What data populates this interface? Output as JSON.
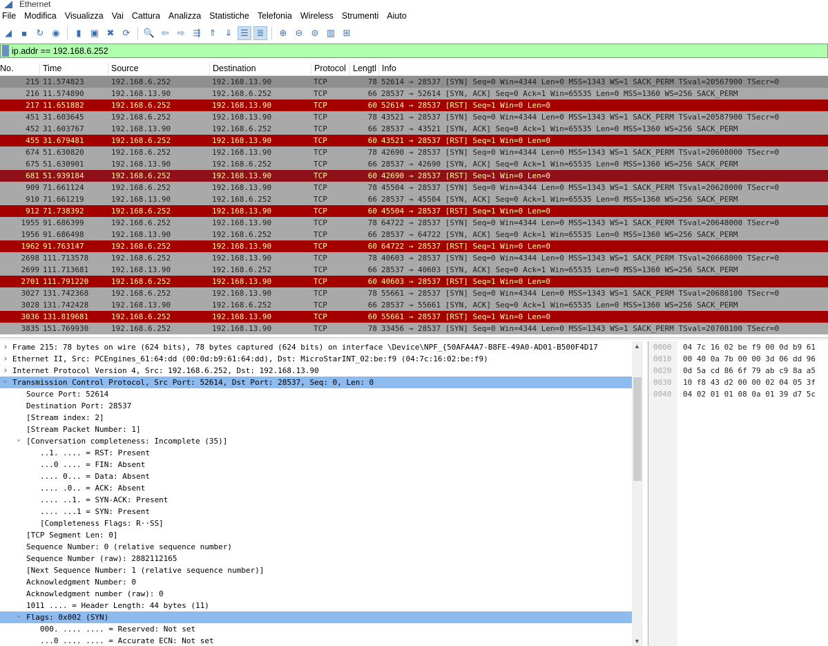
{
  "window": {
    "title": "Ethernet"
  },
  "menu": [
    "File",
    "Modifica",
    "Visualizza",
    "Vai",
    "Cattura",
    "Analizza",
    "Statistiche",
    "Telefonia",
    "Wireless",
    "Strumenti",
    "Aiuto"
  ],
  "toolbar": [
    {
      "name": "start-capture-icon",
      "glyph": "◢"
    },
    {
      "name": "stop-capture-icon",
      "glyph": "■"
    },
    {
      "name": "restart-capture-icon",
      "glyph": "↻"
    },
    {
      "name": "capture-options-icon",
      "glyph": "◉"
    },
    {
      "sep": true
    },
    {
      "name": "open-file-icon",
      "glyph": "▮"
    },
    {
      "name": "save-file-icon",
      "glyph": "▣"
    },
    {
      "name": "close-file-icon",
      "glyph": "✖"
    },
    {
      "name": "reload-file-icon",
      "glyph": "⟳"
    },
    {
      "sep": true
    },
    {
      "name": "find-packet-icon",
      "glyph": "🔍"
    },
    {
      "name": "go-back-icon",
      "glyph": "⇦"
    },
    {
      "name": "go-forward-icon",
      "glyph": "⇨"
    },
    {
      "name": "go-to-packet-icon",
      "glyph": "⇶"
    },
    {
      "name": "first-packet-icon",
      "glyph": "⇑"
    },
    {
      "name": "last-packet-icon",
      "glyph": "⇓"
    },
    {
      "name": "autoscroll-icon",
      "glyph": "☰",
      "active": true
    },
    {
      "name": "colorize-icon",
      "glyph": "≣",
      "active": true
    },
    {
      "sep": true
    },
    {
      "name": "zoom-in-icon",
      "glyph": "⊕"
    },
    {
      "name": "zoom-out-icon",
      "glyph": "⊖"
    },
    {
      "name": "zoom-reset-icon",
      "glyph": "⊜"
    },
    {
      "name": "resize-columns-icon",
      "glyph": "▥"
    },
    {
      "name": "layout-icon",
      "glyph": "⊞"
    }
  ],
  "filter": {
    "value": "ip.addr == 192.168.6.252"
  },
  "columns": [
    "No.",
    "Time",
    "Source",
    "Destination",
    "Protocol",
    "Lengtl",
    "Info"
  ],
  "packets": [
    {
      "no": "215",
      "time": "11.574823",
      "src": "192.168.6.252",
      "dst": "192.168.13.90",
      "proto": "TCP",
      "len": "78",
      "info": "52614 → 28537 [SYN] Seq=0 Win=4344 Len=0 MSS=1343 WS=1 SACK_PERM TSval=20567900 TSecr=0",
      "style": "sel"
    },
    {
      "no": "216",
      "time": "11.574890",
      "src": "192.168.13.90",
      "dst": "192.168.6.252",
      "proto": "TCP",
      "len": "66",
      "info": "28537 → 52614 [SYN, ACK] Seq=0 Ack=1 Win=65535 Len=0 MSS=1360 WS=256 SACK_PERM",
      "style": "ok"
    },
    {
      "no": "217",
      "time": "11.651882",
      "src": "192.168.6.252",
      "dst": "192.168.13.90",
      "proto": "TCP",
      "len": "60",
      "info": "52614 → 28537 [RST] Seq=1 Win=0 Len=0",
      "style": "rst"
    },
    {
      "no": "451",
      "time": "31.603645",
      "src": "192.168.6.252",
      "dst": "192.168.13.90",
      "proto": "TCP",
      "len": "78",
      "info": "43521 → 28537 [SYN] Seq=0 Win=4344 Len=0 MSS=1343 WS=1 SACK_PERM TSval=20587900 TSecr=0",
      "style": "ok"
    },
    {
      "no": "452",
      "time": "31.603767",
      "src": "192.168.13.90",
      "dst": "192.168.6.252",
      "proto": "TCP",
      "len": "66",
      "info": "28537 → 43521 [SYN, ACK] Seq=0 Ack=1 Win=65535 Len=0 MSS=1360 WS=256 SACK_PERM",
      "style": "ok"
    },
    {
      "no": "455",
      "time": "31.679481",
      "src": "192.168.6.252",
      "dst": "192.168.13.90",
      "proto": "TCP",
      "len": "60",
      "info": "43521 → 28537 [RST] Seq=1 Win=0 Len=0",
      "style": "rst"
    },
    {
      "no": "674",
      "time": "51.630820",
      "src": "192.168.6.252",
      "dst": "192.168.13.90",
      "proto": "TCP",
      "len": "78",
      "info": "42690 → 28537 [SYN] Seq=0 Win=4344 Len=0 MSS=1343 WS=1 SACK_PERM TSval=20608000 TSecr=0",
      "style": "ok"
    },
    {
      "no": "675",
      "time": "51.630901",
      "src": "192.168.13.90",
      "dst": "192.168.6.252",
      "proto": "TCP",
      "len": "66",
      "info": "28537 → 42690 [SYN, ACK] Seq=0 Ack=1 Win=65535 Len=0 MSS=1360 WS=256 SACK_PERM",
      "style": "ok"
    },
    {
      "no": "681",
      "time": "51.939184",
      "src": "192.168.6.252",
      "dst": "192.168.13.90",
      "proto": "TCP",
      "len": "60",
      "info": "42690 → 28537 [RST] Seq=1 Win=0 Len=0",
      "style": "mark"
    },
    {
      "no": "909",
      "time": "71.661124",
      "src": "192.168.6.252",
      "dst": "192.168.13.90",
      "proto": "TCP",
      "len": "78",
      "info": "45504 → 28537 [SYN] Seq=0 Win=4344 Len=0 MSS=1343 WS=1 SACK_PERM TSval=20628000 TSecr=0",
      "style": "ok"
    },
    {
      "no": "910",
      "time": "71.661219",
      "src": "192.168.13.90",
      "dst": "192.168.6.252",
      "proto": "TCP",
      "len": "66",
      "info": "28537 → 45504 [SYN, ACK] Seq=0 Ack=1 Win=65535 Len=0 MSS=1360 WS=256 SACK_PERM",
      "style": "ok"
    },
    {
      "no": "912",
      "time": "71.738392",
      "src": "192.168.6.252",
      "dst": "192.168.13.90",
      "proto": "TCP",
      "len": "60",
      "info": "45504 → 28537 [RST] Seq=1 Win=0 Len=0",
      "style": "rst"
    },
    {
      "no": "1955",
      "time": "91.686399",
      "src": "192.168.6.252",
      "dst": "192.168.13.90",
      "proto": "TCP",
      "len": "78",
      "info": "64722 → 28537 [SYN] Seq=0 Win=4344 Len=0 MSS=1343 WS=1 SACK_PERM TSval=20648000 TSecr=0",
      "style": "ok"
    },
    {
      "no": "1956",
      "time": "91.686498",
      "src": "192.168.13.90",
      "dst": "192.168.6.252",
      "proto": "TCP",
      "len": "66",
      "info": "28537 → 64722 [SYN, ACK] Seq=0 Ack=1 Win=65535 Len=0 MSS=1360 WS=256 SACK_PERM",
      "style": "ok"
    },
    {
      "no": "1962",
      "time": "91.763147",
      "src": "192.168.6.252",
      "dst": "192.168.13.90",
      "proto": "TCP",
      "len": "60",
      "info": "64722 → 28537 [RST] Seq=1 Win=0 Len=0",
      "style": "rst"
    },
    {
      "no": "2698",
      "time": "111.713578",
      "src": "192.168.6.252",
      "dst": "192.168.13.90",
      "proto": "TCP",
      "len": "78",
      "info": "40603 → 28537 [SYN] Seq=0 Win=4344 Len=0 MSS=1343 WS=1 SACK_PERM TSval=20668000 TSecr=0",
      "style": "ok"
    },
    {
      "no": "2699",
      "time": "111.713681",
      "src": "192.168.13.90",
      "dst": "192.168.6.252",
      "proto": "TCP",
      "len": "66",
      "info": "28537 → 40603 [SYN, ACK] Seq=0 Ack=1 Win=65535 Len=0 MSS=1360 WS=256 SACK_PERM",
      "style": "ok"
    },
    {
      "no": "2701",
      "time": "111.791220",
      "src": "192.168.6.252",
      "dst": "192.168.13.90",
      "proto": "TCP",
      "len": "60",
      "info": "40603 → 28537 [RST] Seq=1 Win=0 Len=0",
      "style": "rst"
    },
    {
      "no": "3027",
      "time": "131.742368",
      "src": "192.168.6.252",
      "dst": "192.168.13.90",
      "proto": "TCP",
      "len": "78",
      "info": "55661 → 28537 [SYN] Seq=0 Win=4344 Len=0 MSS=1343 WS=1 SACK_PERM TSval=20688100 TSecr=0",
      "style": "ok"
    },
    {
      "no": "3028",
      "time": "131.742428",
      "src": "192.168.13.90",
      "dst": "192.168.6.252",
      "proto": "TCP",
      "len": "66",
      "info": "28537 → 55661 [SYN, ACK] Seq=0 Ack=1 Win=65535 Len=0 MSS=1360 WS=256 SACK_PERM",
      "style": "ok"
    },
    {
      "no": "3036",
      "time": "131.819681",
      "src": "192.168.6.252",
      "dst": "192.168.13.90",
      "proto": "TCP",
      "len": "60",
      "info": "55661 → 28537 [RST] Seq=1 Win=0 Len=0",
      "style": "rst"
    },
    {
      "no": "3835",
      "time": "151.769930",
      "src": "192.168.6.252",
      "dst": "192.168.13.90",
      "proto": "TCP",
      "len": "78",
      "info": "33456 → 28537 [SYN] Seq=0 Win=4344 Len=0 MSS=1343 WS=1 SACK_PERM TSval=20708100 TSecr=0",
      "style": "ok"
    }
  ],
  "row_colors": {
    "ok": "#a9a9a9",
    "sel": "#8f8f8f",
    "rst": "#a40000",
    "mark": "#8f1018",
    "rst_text": "#fffc9c"
  },
  "details": [
    {
      "level": 0,
      "exp": "collapsed",
      "text": "Frame 215: 78 bytes on wire (624 bits), 78 bytes captured (624 bits) on interface \\Device\\NPF_{50AFA4A7-B8FE-49A0-AD01-B500F4D17"
    },
    {
      "level": 0,
      "exp": "collapsed",
      "text": "Ethernet II, Src: PCEngines_61:64:dd (00:0d:b9:61:64:dd), Dst: MicroStarINT_02:be:f9 (04:7c:16:02:be:f9)"
    },
    {
      "level": 0,
      "exp": "collapsed",
      "text": "Internet Protocol Version 4, Src: 192.168.6.252, Dst: 192.168.13.90"
    },
    {
      "level": 0,
      "exp": "expanded",
      "text": "Transmission Control Protocol, Src Port: 52614, Dst Port: 28537, Seq: 0, Len: 0",
      "selected": true
    },
    {
      "level": 1,
      "text": "Source Port: 52614"
    },
    {
      "level": 1,
      "text": "Destination Port: 28537"
    },
    {
      "level": 1,
      "text": "[Stream index: 2]"
    },
    {
      "level": 1,
      "text": "[Stream Packet Number: 1]"
    },
    {
      "level": 1,
      "exp": "expanded",
      "text": "[Conversation completeness: Incomplete (35)]"
    },
    {
      "level": 2,
      "text": "..1. .... = RST: Present"
    },
    {
      "level": 2,
      "text": "...0 .... = FIN: Absent"
    },
    {
      "level": 2,
      "text": ".... 0... = Data: Absent"
    },
    {
      "level": 2,
      "text": ".... .0.. = ACK: Absent"
    },
    {
      "level": 2,
      "text": ".... ..1. = SYN-ACK: Present"
    },
    {
      "level": 2,
      "text": ".... ...1 = SYN: Present"
    },
    {
      "level": 2,
      "text": "[Completeness Flags: R··SS]"
    },
    {
      "level": 1,
      "text": "[TCP Segment Len: 0]"
    },
    {
      "level": 1,
      "text": "Sequence Number: 0    (relative sequence number)"
    },
    {
      "level": 1,
      "text": "Sequence Number (raw): 2882112165"
    },
    {
      "level": 1,
      "text": "[Next Sequence Number: 1    (relative sequence number)]"
    },
    {
      "level": 1,
      "text": "Acknowledgment Number: 0"
    },
    {
      "level": 1,
      "text": "Acknowledgment number (raw): 0"
    },
    {
      "level": 1,
      "text": "1011 .... = Header Length: 44 bytes (11)"
    },
    {
      "level": 1,
      "exp": "expanded",
      "text": "Flags: 0x002 (SYN)",
      "selected": true
    },
    {
      "level": 2,
      "text": "000. .... .... = Reserved: Not set"
    },
    {
      "level": 2,
      "text": "...0 .... .... = Accurate ECN: Not set"
    }
  ],
  "hex": [
    {
      "off": "0000",
      "bytes": "04 7c 16 02 be f9 00 0d  b9 61"
    },
    {
      "off": "0010",
      "bytes": "00 40 0a 7b 00 00 3d 06  dd 96"
    },
    {
      "off": "0020",
      "bytes": "0d 5a cd 86 6f 79 ab c9  8a a5"
    },
    {
      "off": "0030",
      "bytes": "10 f8 43 d2 00 00 02 04  05 3f"
    },
    {
      "off": "0040",
      "bytes": "04 02 01 01 08 0a 01 39  d7 5c"
    }
  ]
}
